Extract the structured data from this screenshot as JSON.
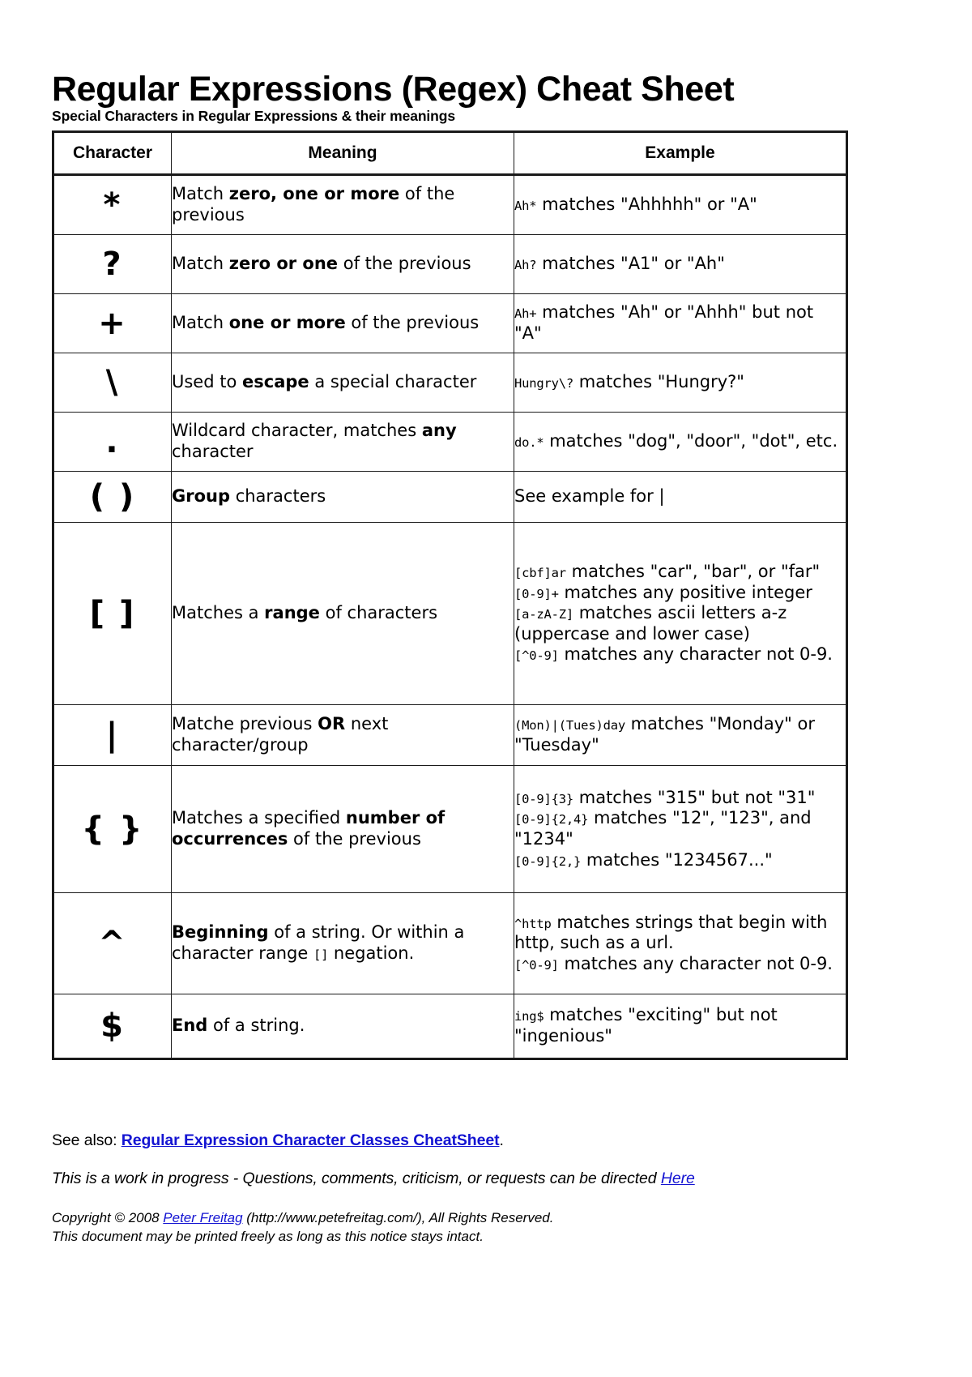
{
  "document": {
    "title": "Regular Expressions (Regex) Cheat Sheet",
    "subtitle": "Special Characters in Regular Expressions & their meanings"
  },
  "table": {
    "headers": {
      "character": "Character",
      "meaning": "Meaning",
      "example": "Example"
    },
    "rows": [
      {
        "character": "*",
        "meaning_pre": "Match ",
        "meaning_bold": "zero, one or more",
        "meaning_post": " of the previous",
        "example_lines": [
          {
            "code": "Ah*",
            "text": " matches \"Ahhhhh\" or \"A\""
          }
        ]
      },
      {
        "character": "?",
        "meaning_pre": "Match ",
        "meaning_bold": "zero or one",
        "meaning_post": " of the previous",
        "example_lines": [
          {
            "code": "Ah?",
            "text": " matches \"A1\" or \"Ah\""
          }
        ]
      },
      {
        "character": "+",
        "meaning_pre": "Match ",
        "meaning_bold": "one or more",
        "meaning_post": " of the previous",
        "example_lines": [
          {
            "code": "Ah+",
            "text": " matches \"Ah\" or \"Ahhh\" but not \"A\""
          }
        ]
      },
      {
        "character": "\\",
        "meaning_pre": "Used to ",
        "meaning_bold": "escape",
        "meaning_post": " a special character",
        "example_lines": [
          {
            "code": "Hungry\\?",
            "text": " matches \"Hungry?\""
          }
        ]
      },
      {
        "character": ".",
        "meaning_pre": "Wildcard character, matches ",
        "meaning_bold": "any",
        "meaning_post": " character",
        "example_lines": [
          {
            "code": "do.*",
            "text": " matches \"dog\", \"door\", \"dot\", etc."
          }
        ]
      },
      {
        "character": "( )",
        "meaning_pre": "",
        "meaning_bold": "Group",
        "meaning_post": " characters",
        "example_lines": [
          {
            "code": "",
            "text": "See example for |"
          }
        ]
      },
      {
        "character": "[ ]",
        "meaning_pre": "Matches a ",
        "meaning_bold": "range",
        "meaning_post": " of characters",
        "example_lines": [
          {
            "code": "[cbf]ar",
            "text": " matches \"car\", \"bar\", or \"far\""
          },
          {
            "code": "[0-9]+",
            "text": " matches any positive integer"
          },
          {
            "code": "[a-zA-Z]",
            "text": " matches ascii letters a-z (uppercase and lower case)"
          },
          {
            "code": "[^0-9]",
            "text": " matches any character not 0-9."
          }
        ]
      },
      {
        "character": "|",
        "meaning_pre": "Matche previous ",
        "meaning_bold": "OR",
        "meaning_post": " next character/group",
        "example_lines": [
          {
            "code": "(Mon)|(Tues)day",
            "text": " matches \"Monday\" or \"Tuesday\""
          }
        ]
      },
      {
        "character": "{ }",
        "meaning_pre": "Matches a specified ",
        "meaning_bold": "number of occurrences",
        "meaning_post": " of the previous",
        "example_lines": [
          {
            "code": "[0-9]{3}",
            "text": " matches \"315\" but not \"31\""
          },
          {
            "code": "[0-9]{2,4}",
            "text": " matches \"12\", \"123\", and \"1234\""
          },
          {
            "code": "[0-9]{2,}",
            "text": " matches \"1234567...\""
          }
        ]
      },
      {
        "character": "^",
        "meaning_pre": "",
        "meaning_bold": "Beginning",
        "meaning_post": " of a string. Or within a character range ",
        "meaning_code": "[]",
        "meaning_tail": " negation.",
        "example_lines": [
          {
            "code": "^http",
            "text": " matches strings that begin with http, such as a url."
          },
          {
            "code": "[^0-9]",
            "text": " matches any character not 0-9."
          }
        ]
      },
      {
        "character": "$",
        "meaning_pre": "",
        "meaning_bold": "End",
        "meaning_post": " of a string.",
        "example_lines": [
          {
            "code": "ing$",
            "text": " matches \"exciting\" but not \"ingenious\""
          }
        ]
      }
    ]
  },
  "footer": {
    "see_also_prefix": "See also: ",
    "see_also_link": "Regular Expression Character Classes CheatSheet",
    "see_also_suffix": ".",
    "wip_text": "This is a work in progress - Questions, comments, criticism, or requests can be directed ",
    "wip_link": "Here",
    "copyright_prefix": "Copyright © 2008 ",
    "copyright_link": "Peter Freitag",
    "copyright_suffix": " (http://www.petefreitag.com/), All Rights Reserved.",
    "copyright_line2": "This document may be printed freely as long as this notice stays intact."
  },
  "colors": {
    "link": "#1414d2",
    "text": "#000000",
    "border": "#1a1a1a",
    "background": "#ffffff"
  }
}
